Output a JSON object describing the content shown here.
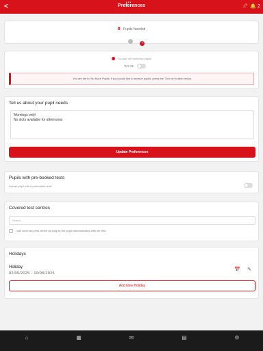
{
  "header": {
    "title": "Preferences",
    "back_glyph": "<",
    "dots": "•••",
    "pin_glyph": "📌",
    "notification_count": "2",
    "bell_glyph": "🔔"
  },
  "pupils_needed": {
    "count": "0",
    "label": "Pupils Needed",
    "minus_glyph": "",
    "plus_glyph": "+"
  },
  "receiving": {
    "status_text": "You are not receiving pupils",
    "toggle_label": "Turn On",
    "notice": "You are set to 'No More Pupils' If you would like to receive pupils, press the 'Turn on' button below."
  },
  "needs": {
    "title": "Tell us about your pupil needs",
    "text": "Mornings only!\nNo slots available for afternoons",
    "update_button": "Update Preferences"
  },
  "prebooked": {
    "title": "Pupils with pre-booked tests",
    "question": "Accept pupil with a prebooked test?"
  },
  "centres": {
    "title": "Covered test centres",
    "search_placeholder": "Search",
    "cover_any_label": "I will cover any test centre as long as the pupil communicates with me first."
  },
  "holidays": {
    "title": "Holidays",
    "items": [
      {
        "name": "Holiday",
        "dates": "02/05/2025 - 10/05/2025"
      }
    ],
    "add_button": "Add New Holiday"
  },
  "bottom_nav": {
    "home_glyph": "⌂",
    "calendar_glyph": "▦",
    "mail_glyph": "✉",
    "bag_glyph": "▤",
    "settings_glyph": "⚙"
  },
  "colors": {
    "accent": "#d8121a",
    "nav_bg": "#1b1b1b"
  }
}
